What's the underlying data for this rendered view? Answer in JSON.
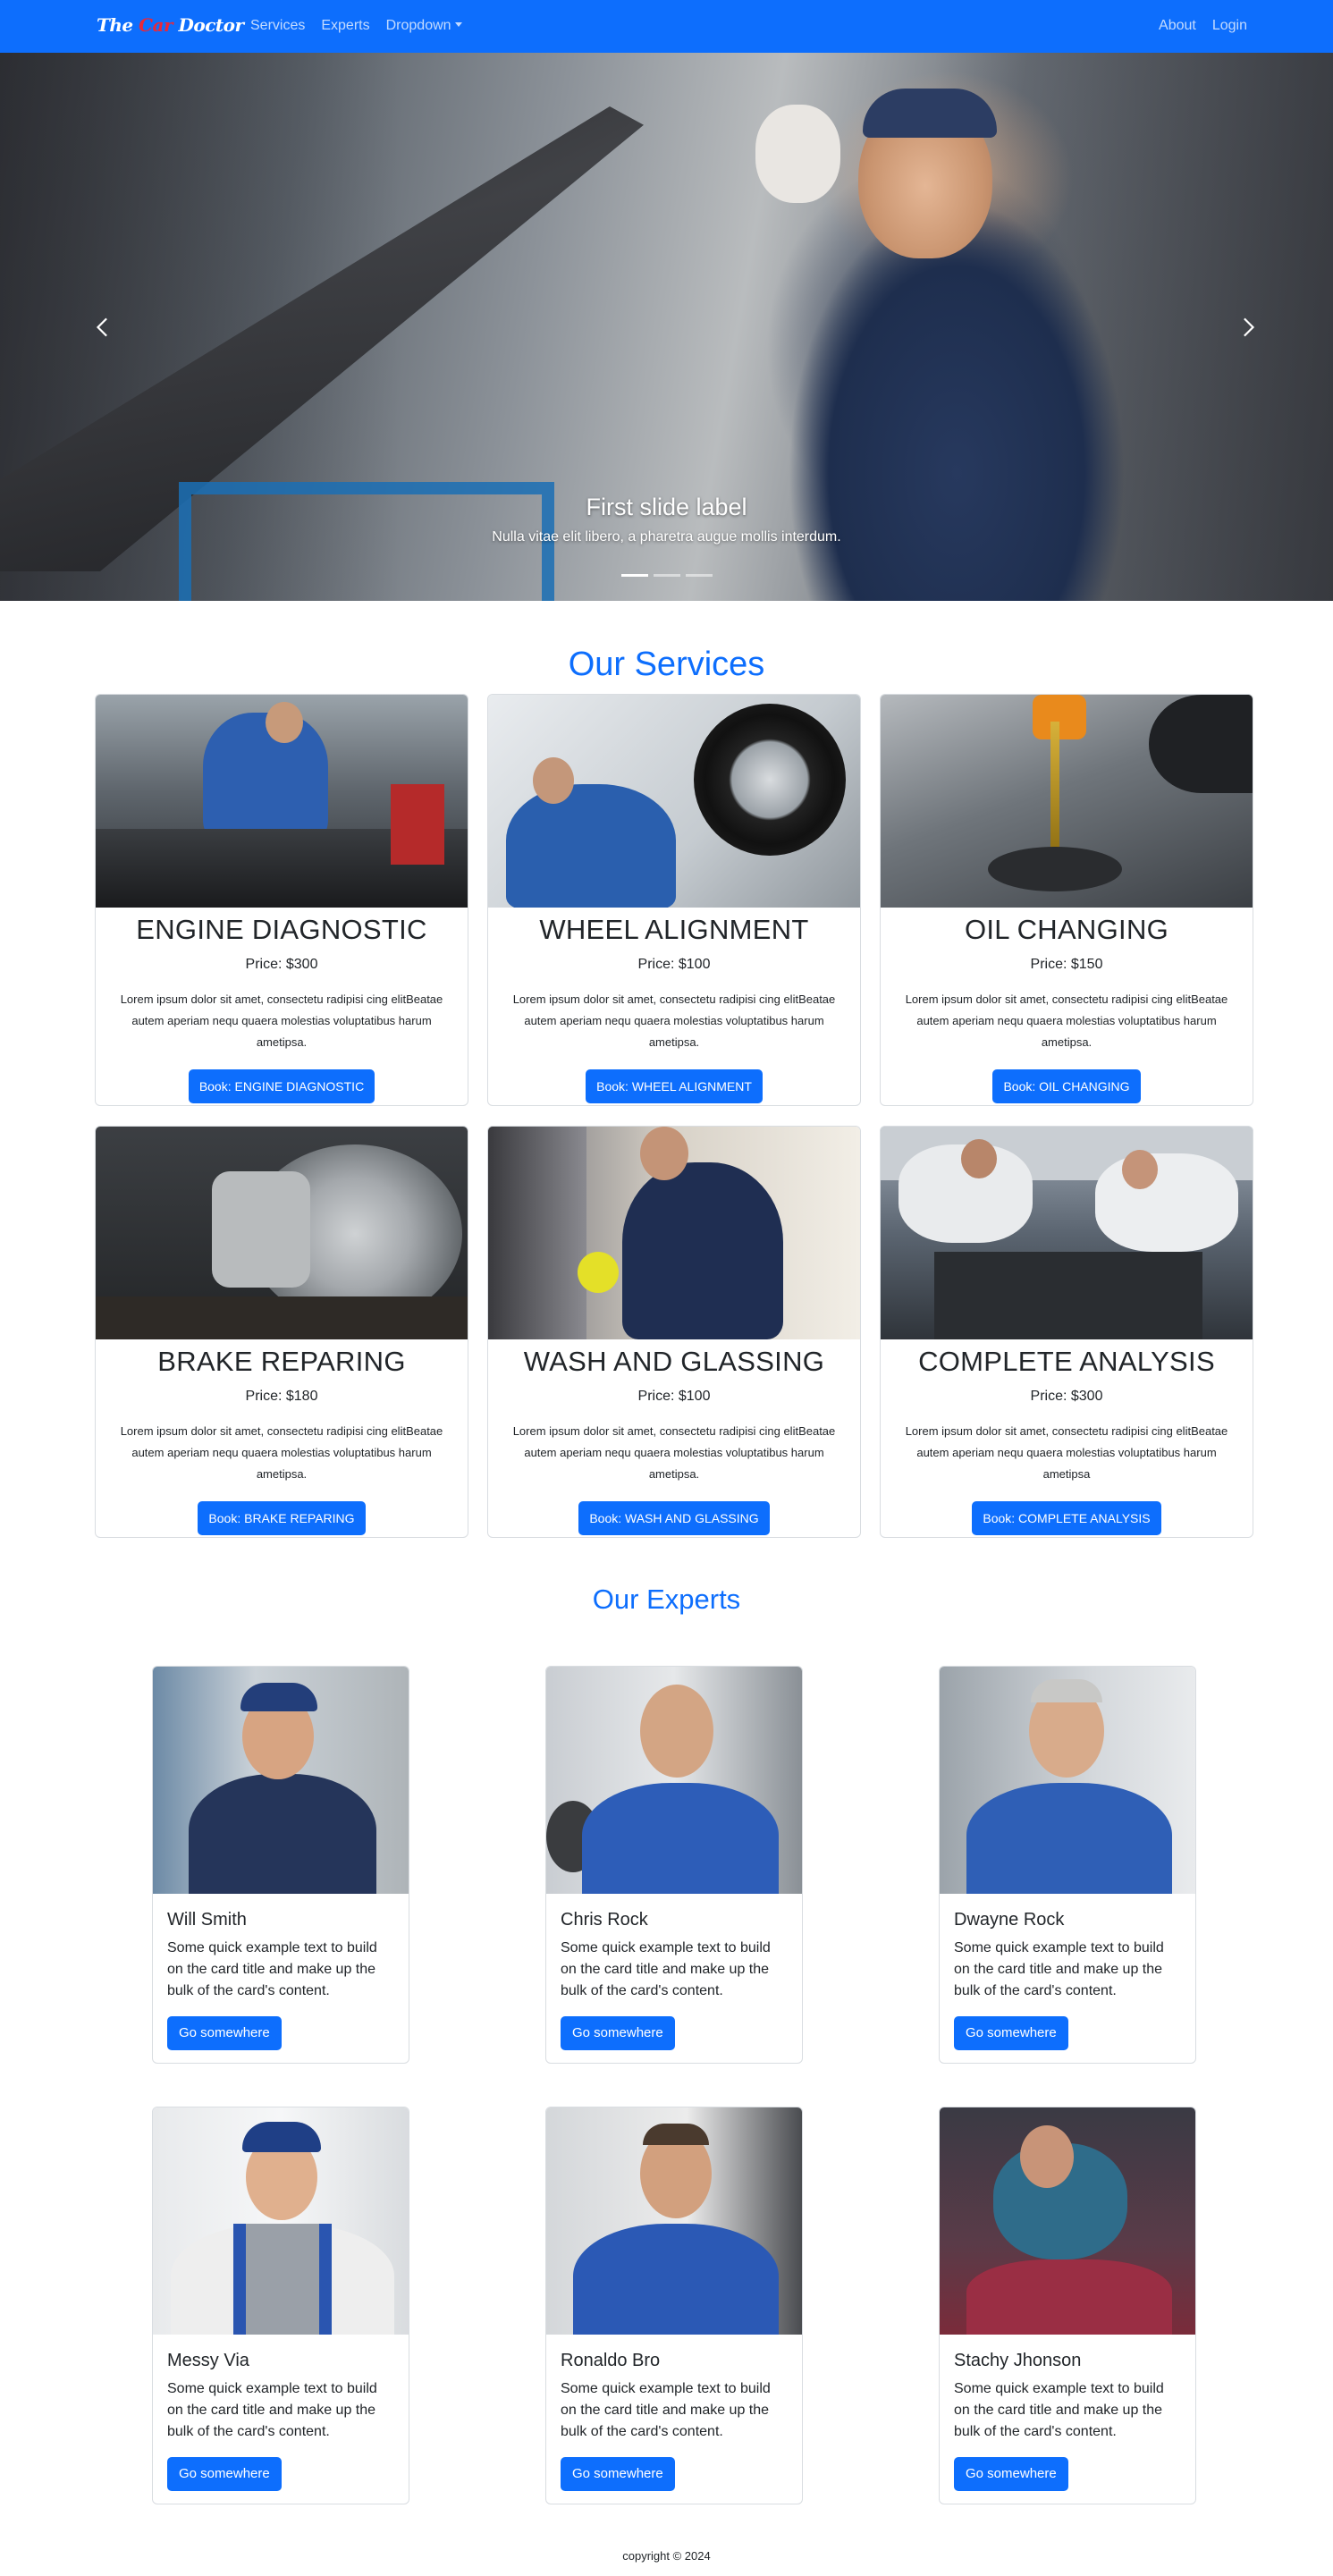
{
  "navbar": {
    "brand_part1": "The ",
    "brand_part2": "Car",
    "brand_part3": " Doctor",
    "links_left": [
      "Services",
      "Experts",
      "Dropdown"
    ],
    "links_right": [
      "About",
      "Login"
    ]
  },
  "carousel": {
    "caption_title": "First slide label",
    "caption_text": "Nulla vitae elit libero, a pharetra augue mollis interdum.",
    "indicator_count": 3,
    "active_indicator": 1
  },
  "services": {
    "title": "Our Services",
    "items": [
      {
        "name": "ENGINE DIAGNOSTIC",
        "price": "Price: $300",
        "desc": "Lorem ipsum dolor sit amet, consectetu radipisi cing elitBeatae autem aperiam nequ quaera molestias voluptatibus harum ametipsa.",
        "button": "Book: ENGINE DIAGNOSTIC"
      },
      {
        "name": "WHEEL ALIGNMENT",
        "price": "Price: $100",
        "desc": "Lorem ipsum dolor sit amet, consectetu radipisi cing elitBeatae autem aperiam nequ quaera molestias voluptatibus harum ametipsa.",
        "button": "Book: WHEEL ALIGNMENT"
      },
      {
        "name": "OIL CHANGING",
        "price": "Price: $150",
        "desc": "Lorem ipsum dolor sit amet, consectetu radipisi cing elitBeatae autem aperiam nequ quaera molestias voluptatibus harum ametipsa.",
        "button": "Book: OIL CHANGING"
      },
      {
        "name": "BRAKE REPARING",
        "price": "Price: $180",
        "desc": "Lorem ipsum dolor sit amet, consectetu radipisi cing elitBeatae autem aperiam nequ quaera molestias voluptatibus harum ametipsa.",
        "button": "Book: BRAKE REPARING"
      },
      {
        "name": "WASH AND GLASSING",
        "price": "Price: $100",
        "desc": "Lorem ipsum dolor sit amet, consectetu radipisi cing elitBeatae autem aperiam nequ quaera molestias voluptatibus harum ametipsa.",
        "button": "Book: WASH AND GLASSING"
      },
      {
        "name": "COMPLETE ANALYSIS",
        "price": "Price: $300",
        "desc": "Lorem ipsum dolor sit amet, consectetu radipisi cing elitBeatae autem aperiam nequ quaera molestias voluptatibus harum ametipsa",
        "button": "Book: COMPLETE ANALYSIS"
      }
    ]
  },
  "experts": {
    "title": "Our Experts",
    "items": [
      {
        "name": "Will Smith",
        "text": "Some quick example text to build on the card title and make up the bulk of the card's content.",
        "button": "Go somewhere"
      },
      {
        "name": "Chris Rock",
        "text": "Some quick example text to build on the card title and make up the bulk of the card's content.",
        "button": "Go somewhere"
      },
      {
        "name": "Dwayne Rock",
        "text": "Some quick example text to build on the card title and make up the bulk of the card's content.",
        "button": "Go somewhere"
      },
      {
        "name": "Messy Via",
        "text": "Some quick example text to build on the card title and make up the bulk of the card's content.",
        "button": "Go somewhere"
      },
      {
        "name": "Ronaldo Bro",
        "text": "Some quick example text to build on the card title and make up the bulk of the card's content.",
        "button": "Go somewhere"
      },
      {
        "name": "Stachy Jhonson",
        "text": "Some quick example text to build on the card title and make up the bulk of the card's content.",
        "button": "Go somewhere"
      }
    ]
  },
  "footer": {
    "text": "copyright © 2024"
  },
  "colors": {
    "primary": "#0d6efd",
    "brand_accent": "#e8283a"
  },
  "icons": {
    "carousel_prev": "chevron-left-icon",
    "carousel_next": "chevron-right-icon",
    "dropdown": "caret-down-icon"
  }
}
